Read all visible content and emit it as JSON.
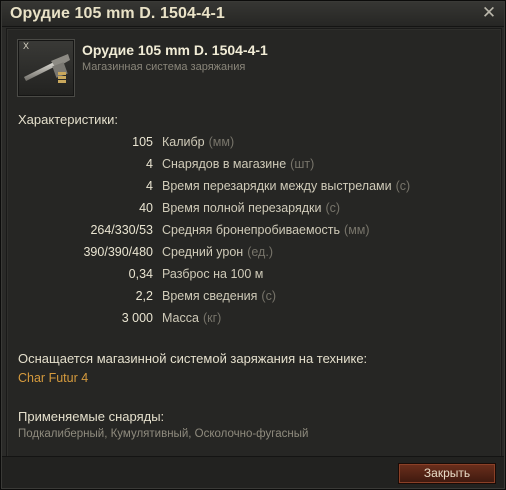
{
  "window": {
    "title": "Орудие 105 mm D. 1504-4-1",
    "close_icon": "close-x-icon"
  },
  "header": {
    "gun_name": "Орудие 105 mm D. 1504-4-1",
    "gun_type": "Магазинная система заряжания",
    "tier_label": "X",
    "icon": "gun-icon"
  },
  "characteristics": {
    "title": "Характеристики:",
    "rows": [
      {
        "value": "105",
        "name": "Калибр",
        "unit": "(мм)"
      },
      {
        "value": "4",
        "name": "Снарядов в магазине",
        "unit": "(шт)"
      },
      {
        "value": "4",
        "name": "Время перезарядки между выстрелами",
        "unit": "(с)"
      },
      {
        "value": "40",
        "name": "Время полной перезарядки",
        "unit": "(с)"
      },
      {
        "value": "264/330/53",
        "name": "Средняя бронепробиваемость",
        "unit": "(мм)"
      },
      {
        "value": "390/390/480",
        "name": "Средний урон",
        "unit": "(ед.)"
      },
      {
        "value": "0,34",
        "name": "Разброс на 100 м",
        "unit": ""
      },
      {
        "value": "2,2",
        "name": "Время сведения",
        "unit": "(с)"
      },
      {
        "value": "3 000",
        "name": "Масса",
        "unit": "(кг)"
      }
    ]
  },
  "vehicles": {
    "title": "Оснащается магазинной системой заряжания на технике:",
    "items": [
      "Char Futur 4"
    ]
  },
  "shells": {
    "title": "Применяемые снаряды:",
    "list": "Подкалиберный, Кумулятивный, Осколочно-фугасный"
  },
  "footer": {
    "close_label": "Закрыть"
  },
  "colors": {
    "background": "#2a2a28",
    "title_text": "#e9e2c7",
    "link_orange": "#d59a3d",
    "button_red": "#6b2f1c"
  }
}
